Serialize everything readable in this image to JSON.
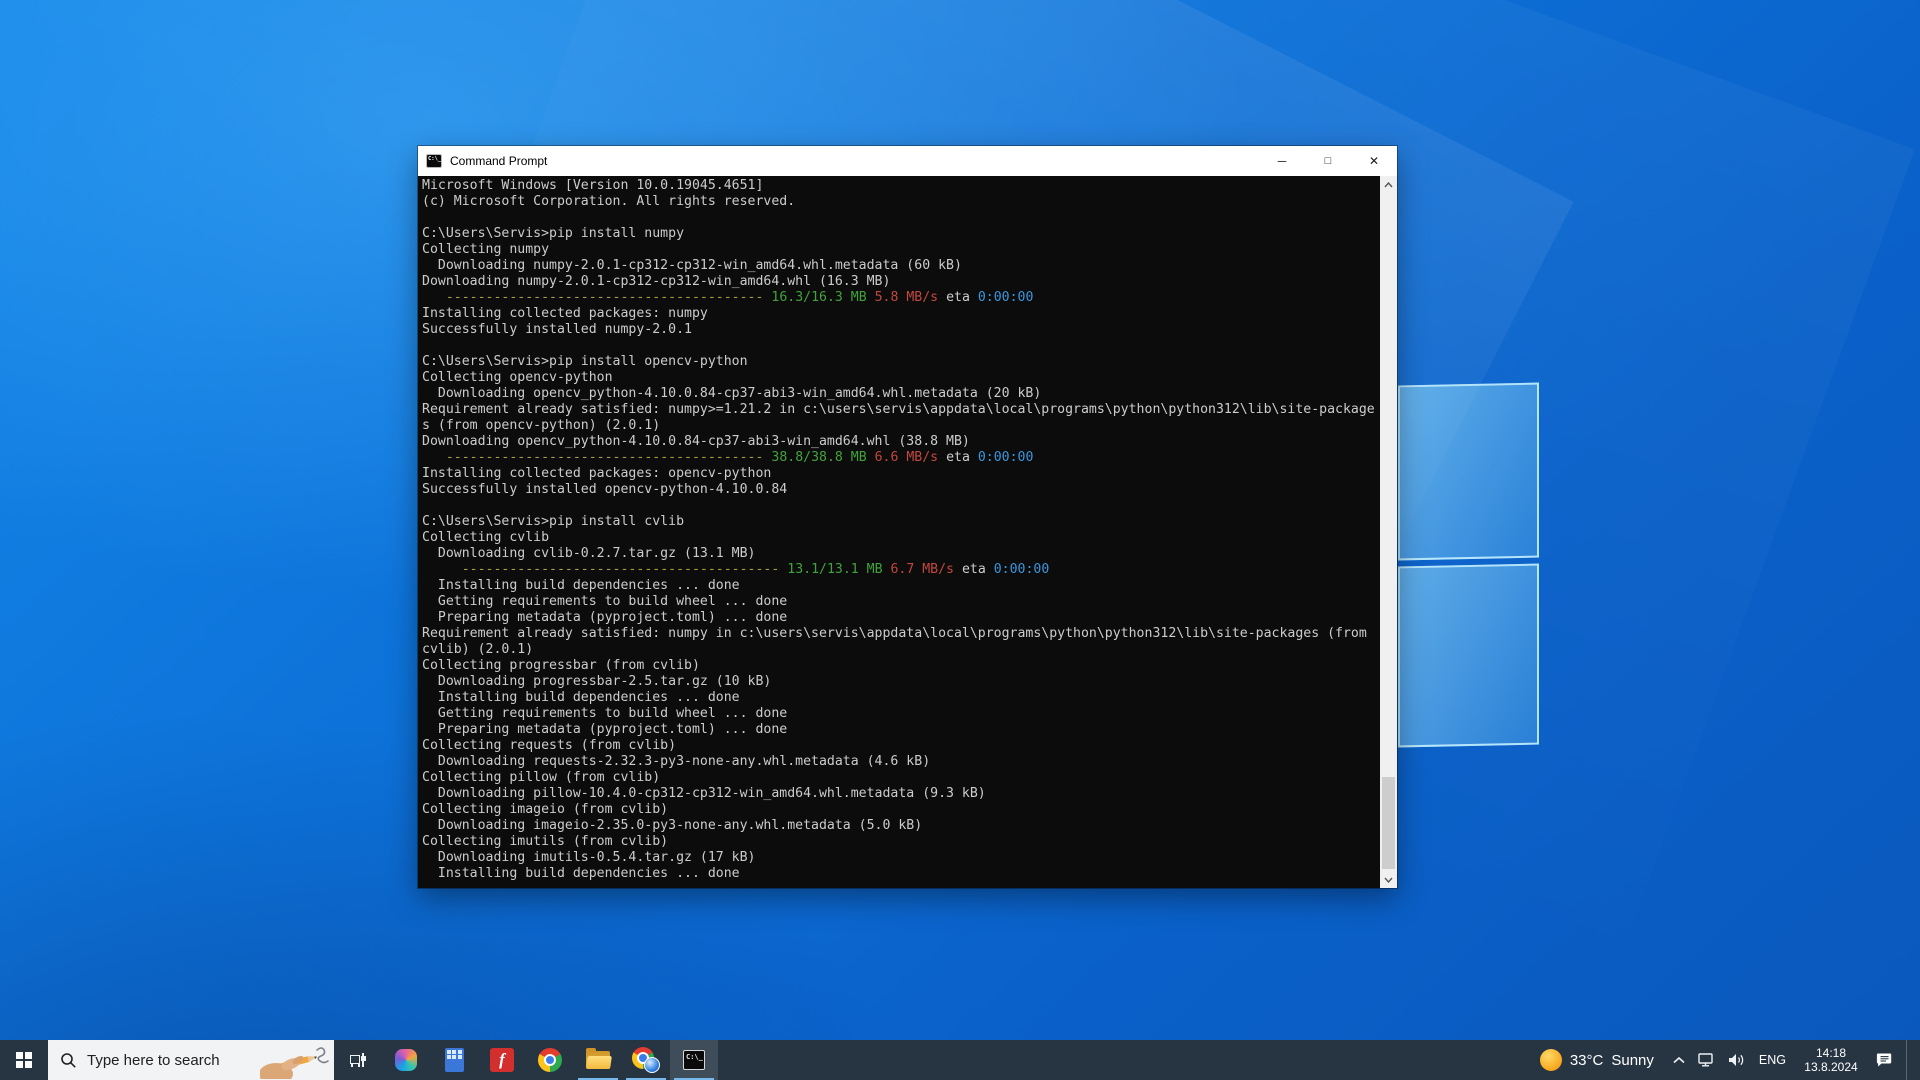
{
  "window": {
    "title": "Command Prompt",
    "icon_glyph": "C:\\_",
    "controls": {
      "minimize": "─",
      "maximize": "□",
      "close": "✕"
    },
    "terminal": {
      "colors": {
        "background": "#0c0c0c",
        "foreground": "#cccccc",
        "bar_yellow": "#a8a43e",
        "size_green": "#42a33c",
        "speed_red": "#c2473f",
        "eta_blue": "#3a96dd"
      },
      "lines": [
        "Microsoft Windows [Version 10.0.19045.4651]",
        "(c) Microsoft Corporation. All rights reserved.",
        "",
        "C:\\Users\\Servis>pip install numpy",
        "Collecting numpy",
        "  Downloading numpy-2.0.1-cp312-cp312-win_amd64.whl.metadata (60 kB)",
        "Downloading numpy-2.0.1-cp312-cp312-win_amd64.whl (16.3 MB)",
        [
          {
            "t": "   ",
            "c": "fg"
          },
          {
            "t": "----------------------------------------",
            "c": "yellow"
          },
          {
            "t": " ",
            "c": "fg"
          },
          {
            "t": "16.3/16.3 MB",
            "c": "green"
          },
          {
            "t": " ",
            "c": "fg"
          },
          {
            "t": "5.8 MB/s",
            "c": "red"
          },
          {
            "t": " eta ",
            "c": "fg"
          },
          {
            "t": "0:00:00",
            "c": "cyan"
          }
        ],
        "Installing collected packages: numpy",
        "Successfully installed numpy-2.0.1",
        "",
        "C:\\Users\\Servis>pip install opencv-python",
        "Collecting opencv-python",
        "  Downloading opencv_python-4.10.0.84-cp37-abi3-win_amd64.whl.metadata (20 kB)",
        "Requirement already satisfied: numpy>=1.21.2 in c:\\users\\servis\\appdata\\local\\programs\\python\\python312\\lib\\site-package",
        "s (from opencv-python) (2.0.1)",
        "Downloading opencv_python-4.10.0.84-cp37-abi3-win_amd64.whl (38.8 MB)",
        [
          {
            "t": "   ",
            "c": "fg"
          },
          {
            "t": "----------------------------------------",
            "c": "yellow"
          },
          {
            "t": " ",
            "c": "fg"
          },
          {
            "t": "38.8/38.8 MB",
            "c": "green"
          },
          {
            "t": " ",
            "c": "fg"
          },
          {
            "t": "6.6 MB/s",
            "c": "red"
          },
          {
            "t": " eta ",
            "c": "fg"
          },
          {
            "t": "0:00:00",
            "c": "cyan"
          }
        ],
        "Installing collected packages: opencv-python",
        "Successfully installed opencv-python-4.10.0.84",
        "",
        "C:\\Users\\Servis>pip install cvlib",
        "Collecting cvlib",
        "  Downloading cvlib-0.2.7.tar.gz (13.1 MB)",
        [
          {
            "t": "     ",
            "c": "fg"
          },
          {
            "t": "----------------------------------------",
            "c": "yellow"
          },
          {
            "t": " ",
            "c": "fg"
          },
          {
            "t": "13.1/13.1 MB",
            "c": "green"
          },
          {
            "t": " ",
            "c": "fg"
          },
          {
            "t": "6.7 MB/s",
            "c": "red"
          },
          {
            "t": " eta ",
            "c": "fg"
          },
          {
            "t": "0:00:00",
            "c": "cyan"
          }
        ],
        "  Installing build dependencies ... done",
        "  Getting requirements to build wheel ... done",
        "  Preparing metadata (pyproject.toml) ... done",
        "Requirement already satisfied: numpy in c:\\users\\servis\\appdata\\local\\programs\\python\\python312\\lib\\site-packages (from",
        "cvlib) (2.0.1)",
        "Collecting progressbar (from cvlib)",
        "  Downloading progressbar-2.5.tar.gz (10 kB)",
        "  Installing build dependencies ... done",
        "  Getting requirements to build wheel ... done",
        "  Preparing metadata (pyproject.toml) ... done",
        "Collecting requests (from cvlib)",
        "  Downloading requests-2.32.3-py3-none-any.whl.metadata (4.6 kB)",
        "Collecting pillow (from cvlib)",
        "  Downloading pillow-10.4.0-cp312-cp312-win_amd64.whl.metadata (9.3 kB)",
        "Collecting imageio (from cvlib)",
        "  Downloading imageio-2.35.0-py3-none-any.whl.metadata (5.0 kB)",
        "Collecting imutils (from cvlib)",
        "  Downloading imutils-0.5.4.tar.gz (17 kB)",
        "  Installing build dependencies ... done"
      ]
    }
  },
  "taskbar": {
    "search_placeholder": "Type here to search",
    "cmd_icon_glyph": "C:\\_",
    "apps": [
      "task-view",
      "copilot",
      "calculator",
      "f-app",
      "chrome",
      "file-explorer",
      "chrome-profile",
      "command-prompt"
    ],
    "open_apps": [
      "file-explorer",
      "chrome-profile",
      "command-prompt"
    ],
    "active_app": "command-prompt",
    "tray": {
      "weather_temp": "33°C",
      "weather_condition": "Sunny",
      "language": "ENG",
      "time": "14:18",
      "date": "13.8.2024"
    }
  },
  "colors": {
    "taskbar": "#273442",
    "accent_underline": "#76b9ed",
    "wallpaper_base": "#0d72d9"
  }
}
